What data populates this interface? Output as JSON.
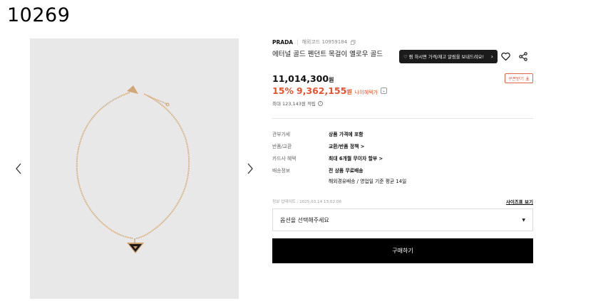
{
  "page_id": "10269",
  "product": {
    "brand": "PRADA",
    "code_label": "해외코드 10959184",
    "title": "에터널 골드 펜던트 목걸이 옐로우 골드",
    "restock_label": "♡ 찜 하시면 가격/재고 알림을 보내드려요!",
    "coupon_label": "쿠폰받기",
    "price_original": "11,014,300",
    "currency": "원",
    "discount": "15%",
    "sale_price": "9,362,155",
    "my_benefit": "나의혜택가",
    "points": "최대 123,143원 적립"
  },
  "details": [
    {
      "label": "관부가세",
      "value": "상품 가격에 포함",
      "extra": ""
    },
    {
      "label": "반품/교환",
      "value": "교환/반품 정책 >",
      "extra": ""
    },
    {
      "label": "카드사 혜택",
      "value": "최대 6개월 무이자 할부 >",
      "extra": ""
    },
    {
      "label": "배송정보",
      "value": "전 상품 무료배송",
      "extra": "해외경유배송 / 영업일 기준 평균 14일"
    }
  ],
  "updated": "정보 업데이트 : 2025.03.14 13:02:06",
  "size_guide": "사이즈표 보기",
  "option_placeholder": "옵션을 선택해주세요",
  "buy_label": "구매하기",
  "colors": {
    "sale": "#e8532f",
    "dark_button": "#1b1b1b",
    "image_bg": "#e9e8e8",
    "chain": "#d9b283"
  }
}
